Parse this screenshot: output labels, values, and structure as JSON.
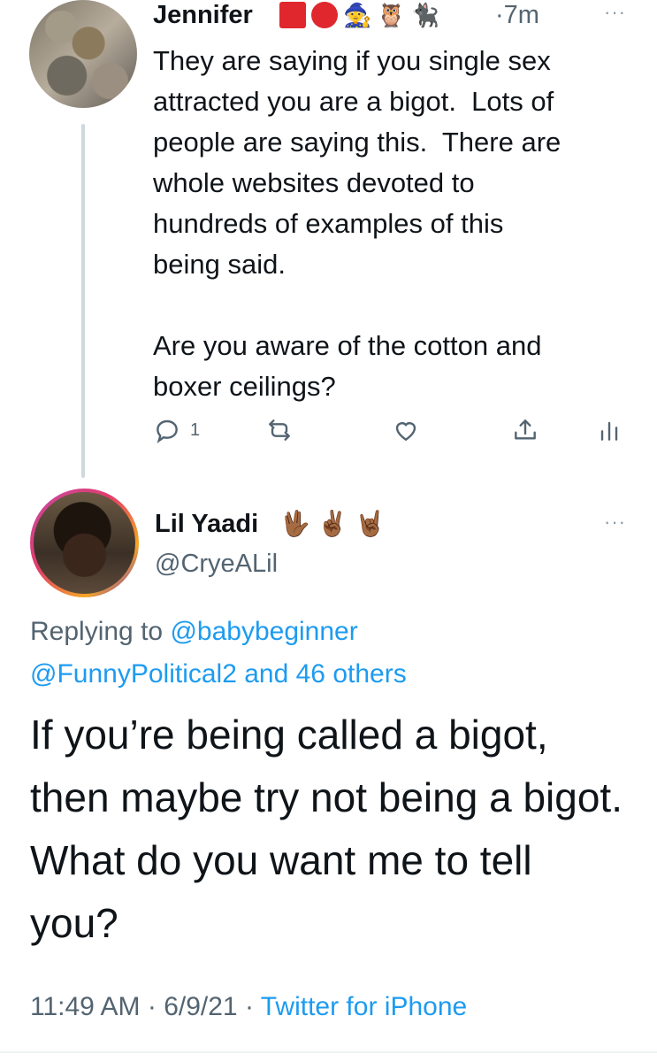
{
  "tweet1": {
    "name": "Jennifer",
    "emojis": [
      "🧙",
      "🦉",
      "🐈‍⬛"
    ],
    "time_sep": "·",
    "time": "7m",
    "more": "···",
    "text": "They are saying if you single sex\nattracted you are a bigot.  Lots of\npeople are saying this.  There are\nwhole websites devoted to\nhundreds of examples of this\nbeing said.\n\nAre you aware of the cotton and\nboxer ceilings?",
    "reply_count": "1",
    "icons": [
      "reply-icon",
      "retweet-icon",
      "like-icon",
      "share-icon",
      "analytics-icon"
    ]
  },
  "tweet2": {
    "name": "Lil Yaadi",
    "emojis": "🖖🏾 ✌🏾 🤘🏾",
    "handle": "@CryeALil",
    "more": "···",
    "replying_prefix": "Replying to ",
    "replying_user1": "@babybeginner",
    "replying_user2": "@FunnyPolitical2 and 46 others",
    "text": "If you’re being called a bigot, then maybe try not being a bigot. What do you want me to tell you?",
    "time": "11:49 AM",
    "date": "6/9/21",
    "sep": " · ",
    "source": "Twitter for iPhone"
  },
  "colors": {
    "accent": "#1d9bf0",
    "secondary_text": "#536471",
    "thread_line": "#cfd9de"
  }
}
